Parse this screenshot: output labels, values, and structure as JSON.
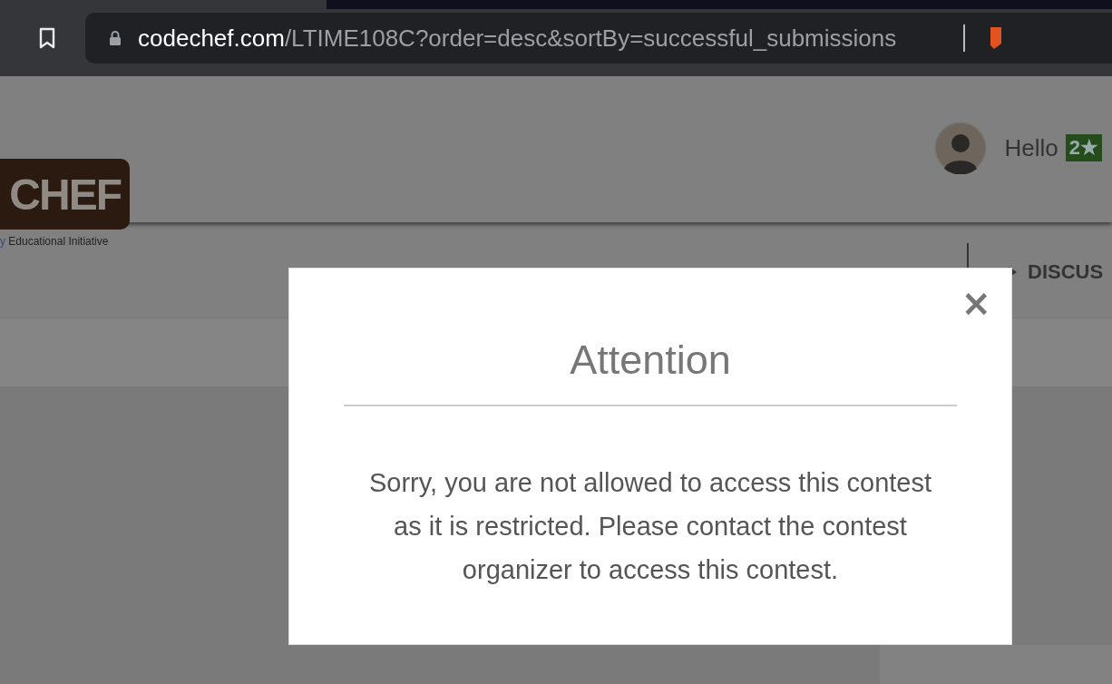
{
  "browser": {
    "url_host": "codechef.com",
    "url_path": "/LTIME108C?order=desc&sortBy=successful_submissions"
  },
  "header": {
    "logo_text": "CHEF",
    "tagline_prefix": "y",
    "tagline": "Educational Initiative",
    "greeting": "Hello",
    "rating_badge": "2★"
  },
  "nav": [
    {
      "label": "DISCUS"
    }
  ],
  "modal": {
    "close": "×",
    "title": "Attention",
    "message": "Sorry, you are not allowed to access this contest as it is restricted. Please contact the contest organizer to access this contest."
  }
}
